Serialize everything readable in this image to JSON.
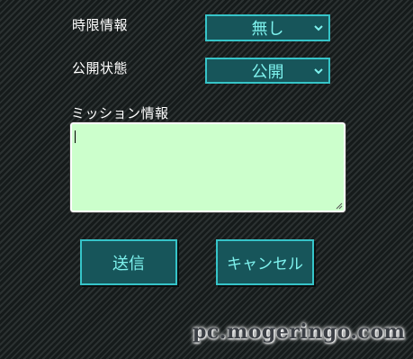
{
  "form": {
    "time_label": "時限情報",
    "time_value": "無し",
    "public_label": "公開状態",
    "public_value": "公開",
    "mission_label": "ミッション情報",
    "mission_text": ""
  },
  "buttons": {
    "submit_label": "送信",
    "cancel_label": "キャンセル"
  },
  "watermark": "pc.mogeringo.com",
  "icons": [
    "chevron-down-icon",
    "resize-grip-icon"
  ],
  "colors": {
    "control_bg": "#17555a",
    "control_border": "#36c4c8",
    "control_text": "#7ef2ee",
    "textarea_bg": "#ccffcc"
  }
}
